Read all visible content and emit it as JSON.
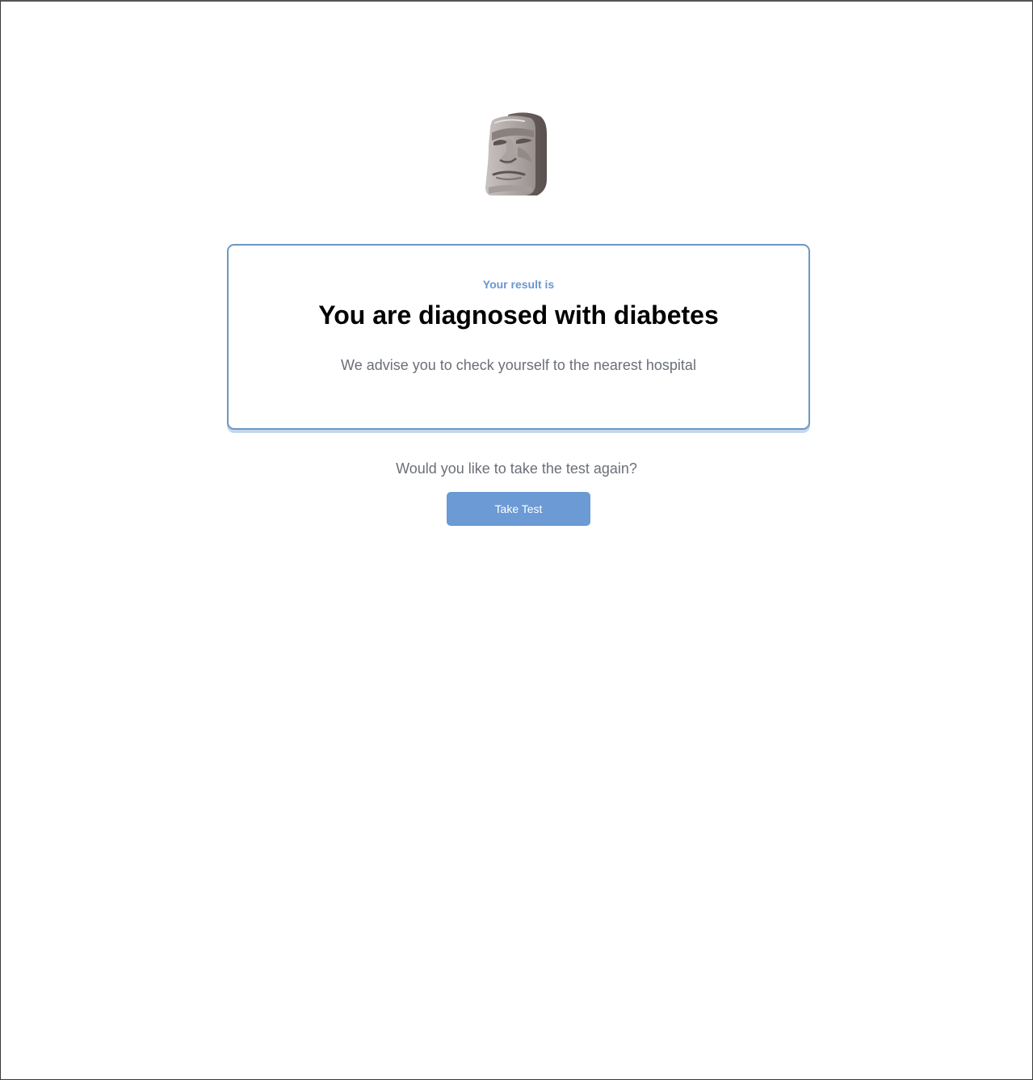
{
  "result": {
    "label": "Your result is",
    "title": "You are diagnosed with diabetes",
    "advice": "We advise you to check yourself to the nearest hospital"
  },
  "retry": {
    "question": "Would you like to take the test again?",
    "button_label": "Take Test"
  },
  "icons": {
    "hero": "moai-icon"
  },
  "colors": {
    "accent": "#6b9ad4",
    "card_border": "#6d96c5",
    "label_text": "#6a96cf",
    "muted_text": "#6b6f77"
  }
}
